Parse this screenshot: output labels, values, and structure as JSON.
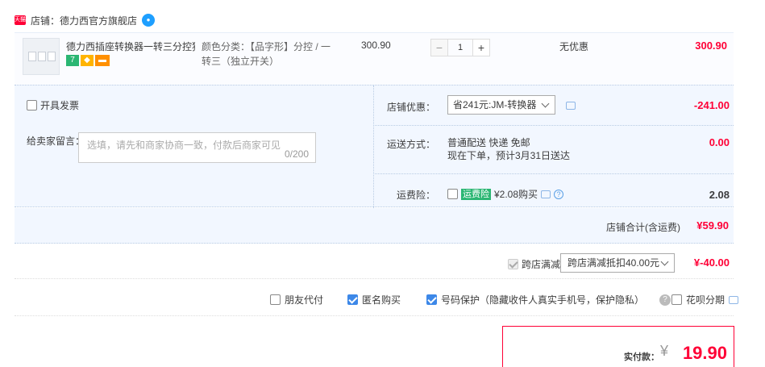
{
  "shop": {
    "logo_text": "天猫",
    "name": "店铺：德力西官方旗舰店"
  },
  "item": {
    "title": "德力西插座转换器一转三分控独...",
    "sku": "颜色分类：【品字形】分控 / 一转三（独立开关）",
    "unit_price": "300.90",
    "quantity": "1",
    "minus": "−",
    "plus": "+",
    "discount": "无优惠",
    "subtotal": "300.90"
  },
  "invoice": {
    "label": "开具发票"
  },
  "message": {
    "label": "给卖家留言：",
    "placeholder": "选填，请先和商家协商一致，付款后商家可见",
    "counter": "0/200"
  },
  "coupon": {
    "label": "店铺优惠：",
    "selected": "省241元:JM-转换器",
    "value": "-241.00"
  },
  "shipping": {
    "label": "运送方式：",
    "line1": "普通配送 快递 免邮",
    "line2": "现在下单，预计3月31日送达",
    "value": "0.00"
  },
  "insurance": {
    "label": "运费险：",
    "badge": "运费险",
    "text": "¥2.08购买",
    "value": "2.08"
  },
  "shop_total": {
    "label": "店铺合计(含运费)",
    "value": "¥59.90"
  },
  "cross_store": {
    "label": "跨店满减",
    "selected": "跨店满减抵扣40.00元",
    "value": "¥-40.00"
  },
  "options": {
    "friend_pay": "朋友代付",
    "anonymous": "匿名购买",
    "number_protect": "号码保护（隐藏收件人真实手机号，保护隐私）",
    "huabei": "花呗分期"
  },
  "payment": {
    "label": "实付款：",
    "currency": "¥",
    "amount": "19.90"
  },
  "colors": {
    "accent": "#ff0036",
    "panel": "#f2f7ff",
    "checkbox": "#3d88e8"
  }
}
